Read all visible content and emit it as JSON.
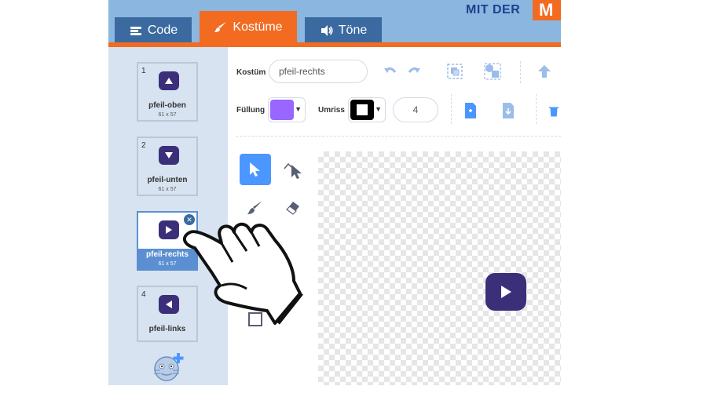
{
  "header": {
    "brand_text": "MIT DER",
    "brand_box": "M",
    "tabs": [
      {
        "label": "Code",
        "icon": "code-icon"
      },
      {
        "label": "Kostüme",
        "icon": "brush-icon"
      },
      {
        "label": "Töne",
        "icon": "speaker-icon"
      }
    ]
  },
  "sidebar": {
    "costumes": [
      {
        "number": "1",
        "name": "pfeil-oben",
        "size": "61 x 57",
        "icon": "arrow-up-icon"
      },
      {
        "number": "2",
        "name": "pfeil-unten",
        "size": "61 x 57",
        "icon": "arrow-down-icon"
      },
      {
        "number": "3",
        "name": "pfeil-rechts",
        "size": "61 x 57",
        "icon": "arrow-right-icon",
        "selected": true
      },
      {
        "number": "4",
        "name": "pfeil-links",
        "size": "",
        "icon": "arrow-left-icon"
      }
    ],
    "add_icon": "add-costume-icon"
  },
  "editor": {
    "costume_label": "Kostüm",
    "costume_name": "pfeil-rechts",
    "fill_label": "Füllung",
    "outline_label": "Umriss",
    "stroke_width": "4",
    "colors": {
      "fill": "#9966ff",
      "outline": "#000000",
      "accent": "#4c97ff",
      "costume_button": "#3b2f7a"
    }
  }
}
